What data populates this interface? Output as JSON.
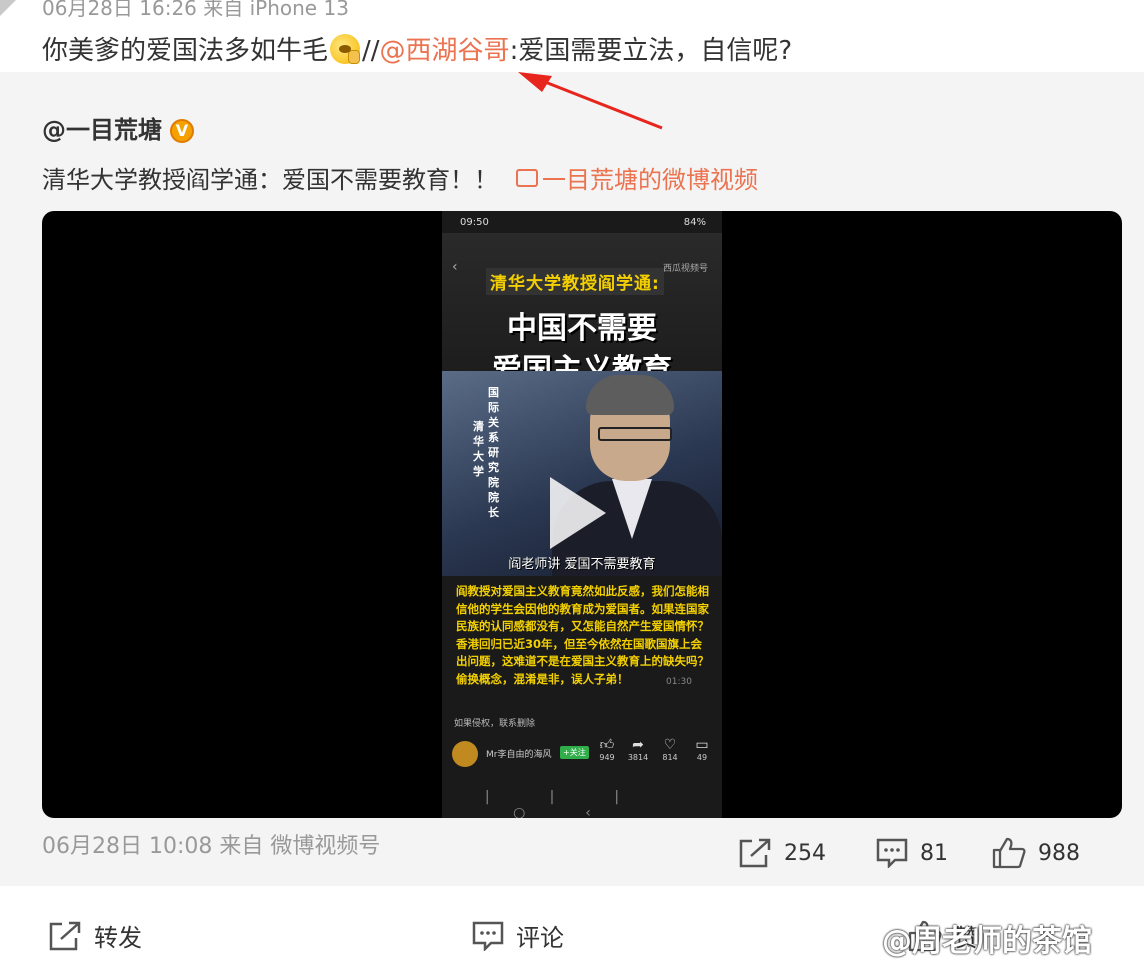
{
  "repost": {
    "meta": "06月28日 16:26  来自 iPhone 13",
    "text_before": "你美爹的爱国法多如牛毛",
    "separator": "//",
    "mention": "@西湖谷哥",
    "text_after": ":爱国需要立法，自信呢?"
  },
  "quoted": {
    "username": "@一目荒塘",
    "verified_badge": "V",
    "text": "清华大学教授阎学通：爱国不需要教育！！",
    "video_link": "一目荒塘的微博视频",
    "time_source": "06月28日 10:08 来自 微博视频号",
    "stats": {
      "repost_count": "254",
      "comment_count": "81",
      "like_count": "988"
    }
  },
  "video_frame": {
    "status_time": "09:50",
    "status_right": "84%",
    "channel_logo": "西瓜视频号",
    "headline1": "清华大学教授阎学通:",
    "headline2": "中国不需要",
    "headline3": "爱国主义教育",
    "side_tag_a": "国际关系研究院院长",
    "side_tag_b": "清华大学",
    "subtitle": "阎老师讲 爱国不需要教育",
    "caption": "阎教授对爱国主义教育竟然如此反感，我们怎能相信他的学生会因他的教育成为爱国者。如果连国家民族的认同感都没有，又怎能自然产生爱国情怀？香港回归已近30年，但至今依然在国歌国旗上会出问题，这难道不是在爱国主义教育上的缺失吗？偷换概念，混淆是非，误人子弟！",
    "time_tag": "01:30",
    "note": "如果侵权，联系删除",
    "author": "Mr李自由的海风",
    "follow": "+关注",
    "likes": "949",
    "shares": "3814",
    "hearts": "814",
    "comments": "49"
  },
  "actions": {
    "repost_label": "转发",
    "comment_label": "评论",
    "like_label": "赞"
  },
  "watermark": "@周老师的茶馆",
  "icons": [
    "share-icon",
    "comment-icon",
    "like-icon",
    "play-icon",
    "verified-icon",
    "video-camera-icon"
  ],
  "colors": {
    "link": "#eb7350",
    "card_bg": "#f4f4f4",
    "arrow": "#e8251c",
    "badge": "#f5a200"
  }
}
